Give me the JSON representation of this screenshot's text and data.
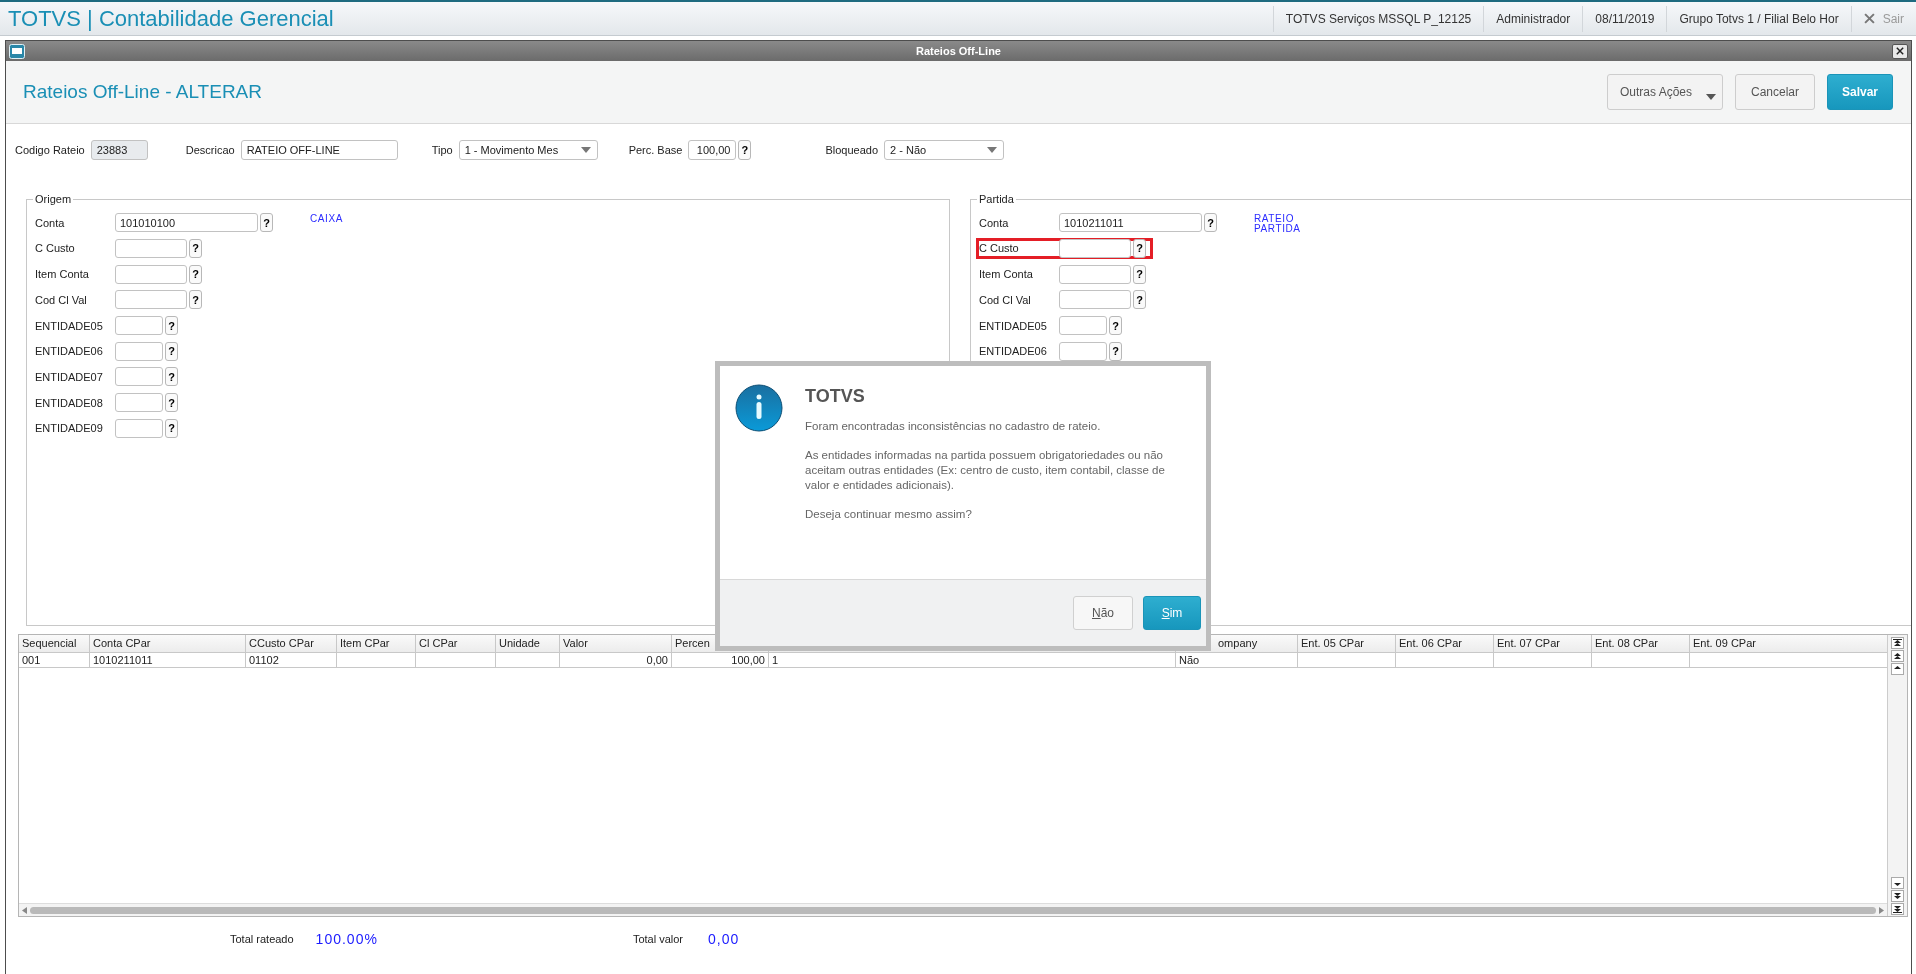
{
  "app_bar": {
    "title": "TOTVS | Contabilidade Gerencial",
    "items": [
      "TOTVS Serviços MSSQL P_12125",
      "Administrador",
      "08/11/2019",
      "Grupo Totvs 1 / Filial Belo Hor"
    ],
    "exit_label": "Sair"
  },
  "window": {
    "title": "Rateios Off-Line",
    "heading": "Rateios Off-Line - ALTERAR",
    "actions": [
      {
        "label": "Outras Ações",
        "kind": "menu"
      },
      {
        "label": "Cancelar",
        "kind": "default"
      },
      {
        "label": "Salvar",
        "kind": "primary"
      }
    ]
  },
  "header_fields": [
    {
      "label": "Codigo Rateio",
      "value": "23883",
      "kind": "text",
      "disabled": true
    },
    {
      "label": "Descricao",
      "value": "RATEIO OFF-LINE",
      "kind": "text",
      "disabled": false
    },
    {
      "label": "Tipo",
      "value": "1 - Movimento Mes",
      "kind": "select"
    },
    {
      "label": "Perc. Base",
      "value": "100,00",
      "kind": "lookup",
      "lookup": "?"
    },
    {
      "label": "Bloqueado",
      "value": "2 - Não",
      "kind": "select"
    }
  ],
  "origem": {
    "legend": "Origem",
    "description": "CAIXA",
    "fields": [
      {
        "label": "Conta",
        "value": "101010100",
        "lookup": "?",
        "highlighted": false
      },
      {
        "label": "C Custo",
        "lookup": "?",
        "highlighted": false
      },
      {
        "label": "Item Conta",
        "lookup": "?",
        "highlighted": false
      },
      {
        "label": "Cod Cl Val",
        "lookup": "?",
        "highlighted": false
      },
      {
        "label": "ENTIDADE05",
        "lookup": "?",
        "highlighted": false
      },
      {
        "label": "ENTIDADE06",
        "lookup": "?",
        "highlighted": false
      },
      {
        "label": "ENTIDADE07",
        "lookup": "?",
        "highlighted": false
      },
      {
        "label": "ENTIDADE08",
        "lookup": "?",
        "highlighted": false
      },
      {
        "label": "ENTIDADE09",
        "lookup": "?",
        "highlighted": false
      }
    ]
  },
  "partida": {
    "legend": "Partida",
    "description": "RATEIO PARTIDA",
    "fields": [
      {
        "label": "Conta",
        "value": "1010211011",
        "lookup": "?",
        "highlighted": false
      },
      {
        "label": "C Custo",
        "lookup": "?",
        "highlighted": true
      },
      {
        "label": "Item Conta",
        "lookup": "?",
        "highlighted": false
      },
      {
        "label": "Cod Cl Val",
        "lookup": "?",
        "highlighted": false
      },
      {
        "label": "ENTIDADE05",
        "lookup": "?",
        "highlighted": false
      },
      {
        "label": "ENTIDADE06",
        "lookup": "?",
        "highlighted": false
      }
    ]
  },
  "grid": {
    "columns": [
      "Sequencial",
      "Conta CPar",
      "CCusto CPar",
      "Item CPar",
      "Cl CPar",
      "Unidade",
      "Valor",
      "Percen",
      null,
      "ompany",
      "Ent. 05 CPar",
      "Ent. 06 CPar",
      "Ent. 07 CPar",
      "Ent. 08 CPar",
      "Ent. 09 CPar"
    ],
    "rows": [
      [
        "001",
        "1010211011",
        "01102",
        null,
        null,
        null,
        "0,00",
        "100,00",
        "1",
        "Não",
        null,
        null,
        null,
        null,
        null
      ]
    ]
  },
  "totals": [
    {
      "label": "Total rateado",
      "value": "100.00%"
    },
    {
      "label": "Total valor",
      "value": "0,00"
    }
  ],
  "dialog": {
    "title": "TOTVS",
    "paragraphs": [
      "Foram encontradas inconsistências no cadastro de rateio.",
      "As entidades informadas na partida possuem obrigatoriedades ou não aceitam outras entidades (Ex: centro de custo, item contabil, classe de valor e entidades adicionais).",
      "Deseja continuar mesmo assim?"
    ],
    "buttons": [
      {
        "label": "Não",
        "kind": "default"
      },
      {
        "label": "Sim",
        "kind": "primary"
      }
    ]
  }
}
